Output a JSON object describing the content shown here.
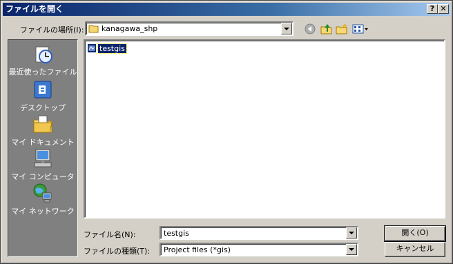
{
  "window": {
    "title": "ファイルを開く",
    "help_label": "?",
    "close_label": "✕"
  },
  "location": {
    "label": "ファイルの場所(I):",
    "value": "kanagawa_shp"
  },
  "places": [
    {
      "label": "最近使ったファイル",
      "icon": "recent-files-icon"
    },
    {
      "label": "デスクトップ",
      "icon": "desktop-icon"
    },
    {
      "label": "マイ ドキュメント",
      "icon": "my-documents-icon"
    },
    {
      "label": "マイ コンピュータ",
      "icon": "my-computer-icon"
    },
    {
      "label": "マイ ネットワーク",
      "icon": "my-network-icon"
    }
  ],
  "files": [
    {
      "name": "testgis",
      "selected": true,
      "icon": "gis-file-icon"
    }
  ],
  "filename": {
    "label": "ファイル名(N):",
    "value": "testgis"
  },
  "filetype": {
    "label": "ファイルの種類(T):",
    "value": "Project files (*gis)"
  },
  "buttons": {
    "open": "開く(O)",
    "cancel": "キャンセル"
  },
  "colors": {
    "title_start": "#0a246a",
    "title_end": "#a6caf0",
    "selection": "#0a246a",
    "face": "#d4d0c8"
  }
}
